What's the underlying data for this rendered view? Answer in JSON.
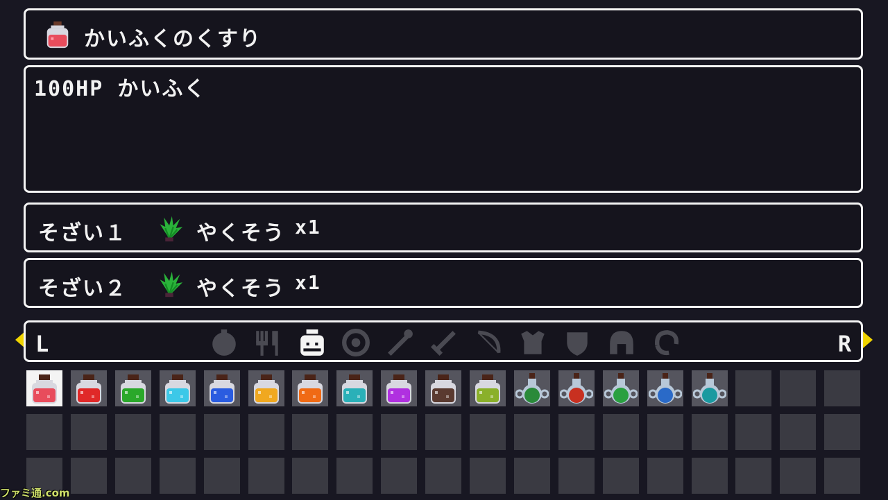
{
  "item": {
    "name": "かいふくのくすり",
    "description": "100HP かいふく",
    "icon": "red-potion-icon",
    "color": "#e84c5c"
  },
  "materials": [
    {
      "label": "そざい１",
      "name": "やくそう",
      "qty": "x1",
      "icon": "herb-icon"
    },
    {
      "label": "そざい２",
      "name": "やくそう",
      "qty": "x1",
      "icon": "herb-icon"
    }
  ],
  "tabs": {
    "left_button": "L",
    "right_button": "R",
    "categories": [
      {
        "icon": "bomb-icon",
        "active": false
      },
      {
        "icon": "food-icon",
        "active": false
      },
      {
        "icon": "potion-jar-icon",
        "active": true
      },
      {
        "icon": "ring-icon",
        "active": false
      },
      {
        "icon": "wand-icon",
        "active": false
      },
      {
        "icon": "sword-icon",
        "active": false
      },
      {
        "icon": "bow-icon",
        "active": false
      },
      {
        "icon": "armor-icon",
        "active": false
      },
      {
        "icon": "shield-icon",
        "active": false
      },
      {
        "icon": "helmet-icon",
        "active": false
      },
      {
        "icon": "bracelet-icon",
        "active": false
      }
    ]
  },
  "inventory": {
    "rows": 3,
    "cols": 19,
    "selected_index": 0,
    "items": [
      {
        "icon": "potion-jar-icon",
        "color": "#e84c5c"
      },
      {
        "icon": "potion-jar-icon",
        "color": "#e02828"
      },
      {
        "icon": "potion-jar-icon",
        "color": "#2aa82a"
      },
      {
        "icon": "potion-jar-icon",
        "color": "#3cc8e8"
      },
      {
        "icon": "potion-jar-icon",
        "color": "#2a5ce0"
      },
      {
        "icon": "potion-jar-icon",
        "color": "#f0a820"
      },
      {
        "icon": "potion-jar-icon",
        "color": "#f06a14"
      },
      {
        "icon": "potion-jar-icon",
        "color": "#2ab0b8"
      },
      {
        "icon": "potion-jar-icon",
        "color": "#b030e0"
      },
      {
        "icon": "potion-jar-icon",
        "color": "#5a3a30"
      },
      {
        "icon": "potion-jar-icon",
        "color": "#8ab02a"
      },
      {
        "icon": "flask-icon",
        "color": "#2a8a3a"
      },
      {
        "icon": "flask-icon",
        "color": "#c83020"
      },
      {
        "icon": "flask-icon",
        "color": "#2aa040"
      },
      {
        "icon": "flask-icon",
        "color": "#2a6ac8"
      },
      {
        "icon": "flask-icon",
        "color": "#1a9aa0"
      }
    ]
  },
  "watermark": "ファミ通.com"
}
